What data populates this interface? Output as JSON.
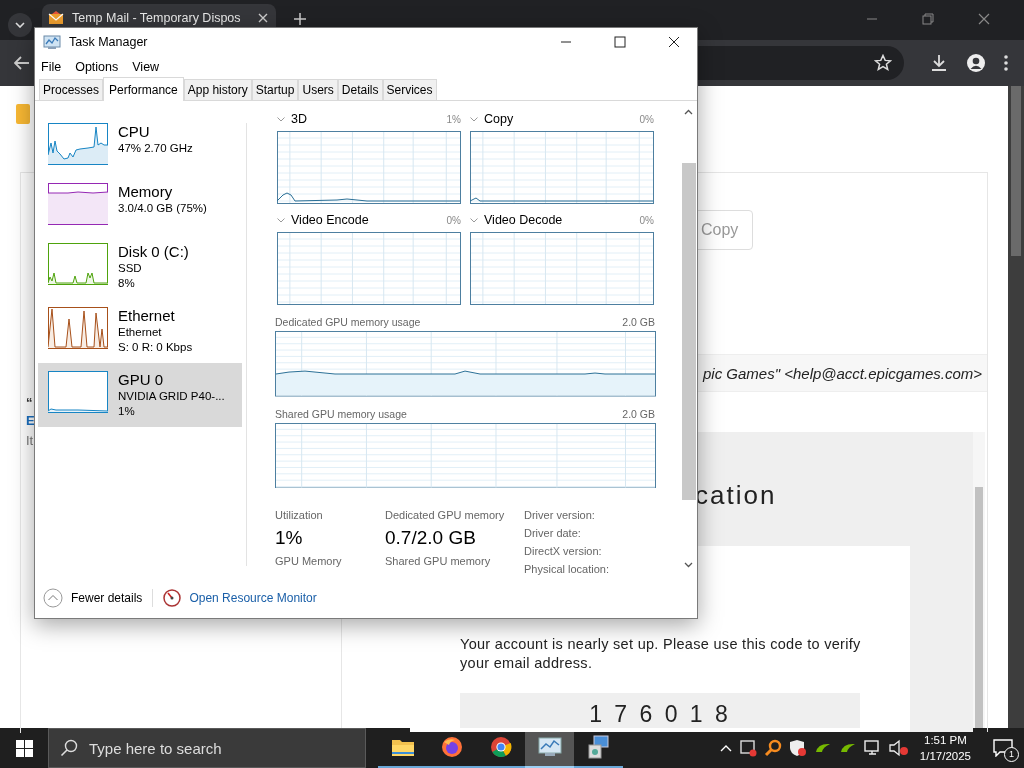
{
  "browser": {
    "tab_title": "Temp Mail - Temporary Dispos",
    "page": {
      "left_fragments": [
        "“",
        "E",
        "It"
      ],
      "copy_button": "Copy",
      "sender": "pic Games\" <help@acct.epicgames.com>",
      "heading": "cation",
      "message": "Your account is nearly set up. Please use this code to verify your email address.",
      "code": "1 7 6 0 1 8"
    }
  },
  "task_manager": {
    "title": "Task Manager",
    "menu": [
      "File",
      "Options",
      "View"
    ],
    "tabs": [
      {
        "label": "Processes",
        "selected": false
      },
      {
        "label": "Performance",
        "selected": true
      },
      {
        "label": "App history",
        "selected": false
      },
      {
        "label": "Startup",
        "selected": false
      },
      {
        "label": "Users",
        "selected": false
      },
      {
        "label": "Details",
        "selected": false
      },
      {
        "label": "Services",
        "selected": false
      }
    ],
    "resources": [
      {
        "kind": "cpu",
        "name": "CPU",
        "lines": [
          "47% 2.70 GHz"
        ],
        "selected": false
      },
      {
        "kind": "memory",
        "name": "Memory",
        "lines": [
          "3.0/4.0 GB (75%)"
        ],
        "selected": false
      },
      {
        "kind": "disk",
        "name": "Disk 0 (C:)",
        "lines": [
          "SSD",
          "8%"
        ],
        "selected": false
      },
      {
        "kind": "ethernet",
        "name": "Ethernet",
        "lines": [
          "Ethernet",
          "S: 0 R: 0 Kbps"
        ],
        "selected": false
      },
      {
        "kind": "gpu",
        "name": "GPU 0",
        "lines": [
          "NVIDIA GRID P40-...",
          "1%"
        ],
        "selected": true
      }
    ],
    "engines": [
      {
        "name": "3D",
        "value": "1%"
      },
      {
        "name": "Copy",
        "value": "0%"
      },
      {
        "name": "Video Encode",
        "value": "0%"
      },
      {
        "name": "Video Decode",
        "value": "0%"
      }
    ],
    "memory_graphs": [
      {
        "label": "Dedicated GPU memory usage",
        "max": "2.0 GB"
      },
      {
        "label": "Shared GPU memory usage",
        "max": "2.0 GB"
      }
    ],
    "stats": [
      {
        "label": "Utilization",
        "value": "1%",
        "next_label": "GPU Memory"
      },
      {
        "label": "Dedicated GPU memory",
        "value": "0.7/2.0 GB",
        "next_label": "Shared GPU memory"
      }
    ],
    "details": [
      "Driver version:",
      "Driver date:",
      "DirectX version:",
      "Physical location:"
    ],
    "fewer_details": "Fewer details",
    "resource_monitor_link": "Open Resource Monitor"
  },
  "taskbar": {
    "search_placeholder": "Type here to search",
    "apps": [
      {
        "kind": "folder",
        "selected": false
      },
      {
        "kind": "firefox",
        "selected": false
      },
      {
        "kind": "chrome",
        "selected": false
      },
      {
        "kind": "taskmanager",
        "selected": true
      },
      {
        "kind": "network-tool",
        "selected": false
      }
    ],
    "time": "1:51 PM",
    "date": "1/17/2025",
    "notification_count": "1"
  }
}
